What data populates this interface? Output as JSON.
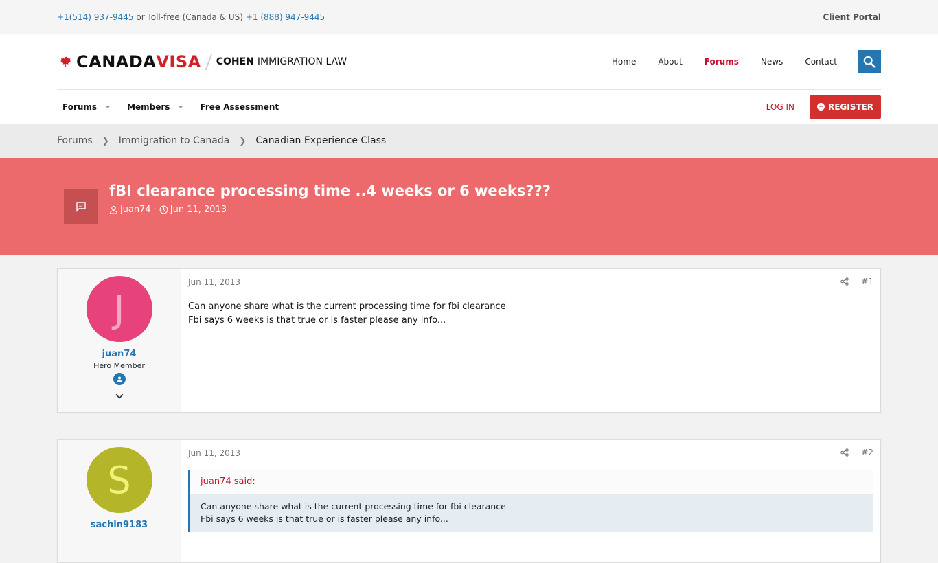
{
  "topbar": {
    "phone_local": "+1(514) 937-9445",
    "phone_sep": "or Toll-free (Canada & US)",
    "phone_tollfree": "+1 (888) 947-9445",
    "client_portal": "Client Portal"
  },
  "header": {
    "logo_canada": "CANADA",
    "logo_visa": "VISA",
    "logo_cohen": "COHEN",
    "logo_law": "IMMIGRATION LAW",
    "nav": [
      "Home",
      "About",
      "Forums",
      "News",
      "Contact"
    ],
    "active_nav": "Forums"
  },
  "subnav": {
    "forums": "Forums",
    "members": "Members",
    "assessment": "Free Assessment",
    "login": "LOG IN",
    "register": "REGISTER"
  },
  "breadcrumb": [
    "Forums",
    "Immigration to Canada",
    "Canadian Experience Class"
  ],
  "thread": {
    "title": "fBI clearance processing time ..4 weeks or 6 weeks???",
    "author": "juan74",
    "date": "Jun 11, 2013"
  },
  "posts": [
    {
      "initial": "J",
      "avatar_bg": "#e8427c",
      "avatar_fg": "#f7a7c6",
      "username": "juan74",
      "user_title": "Hero Member",
      "date": "Jun 11, 2013",
      "number": "#1",
      "line1": "Can anyone share what is the current processing time for fbi clearance",
      "line2": "Fbi says 6 weeks is that true or is faster please any info..."
    },
    {
      "initial": "S",
      "avatar_bg": "#b5b52a",
      "avatar_fg": "#f0f07a",
      "username": "sachin9183",
      "date": "Jun 11, 2013",
      "number": "#2",
      "quote_author": "juan74 said:",
      "quote_line1": "Can anyone share what is the current processing time for fbi clearance",
      "quote_line2": "Fbi says 6 weeks is that true or is faster please any info..."
    }
  ],
  "colors": {
    "brand_red": "#c8102e",
    "link_blue": "#2577b1",
    "banner": "#ec6a6c"
  }
}
